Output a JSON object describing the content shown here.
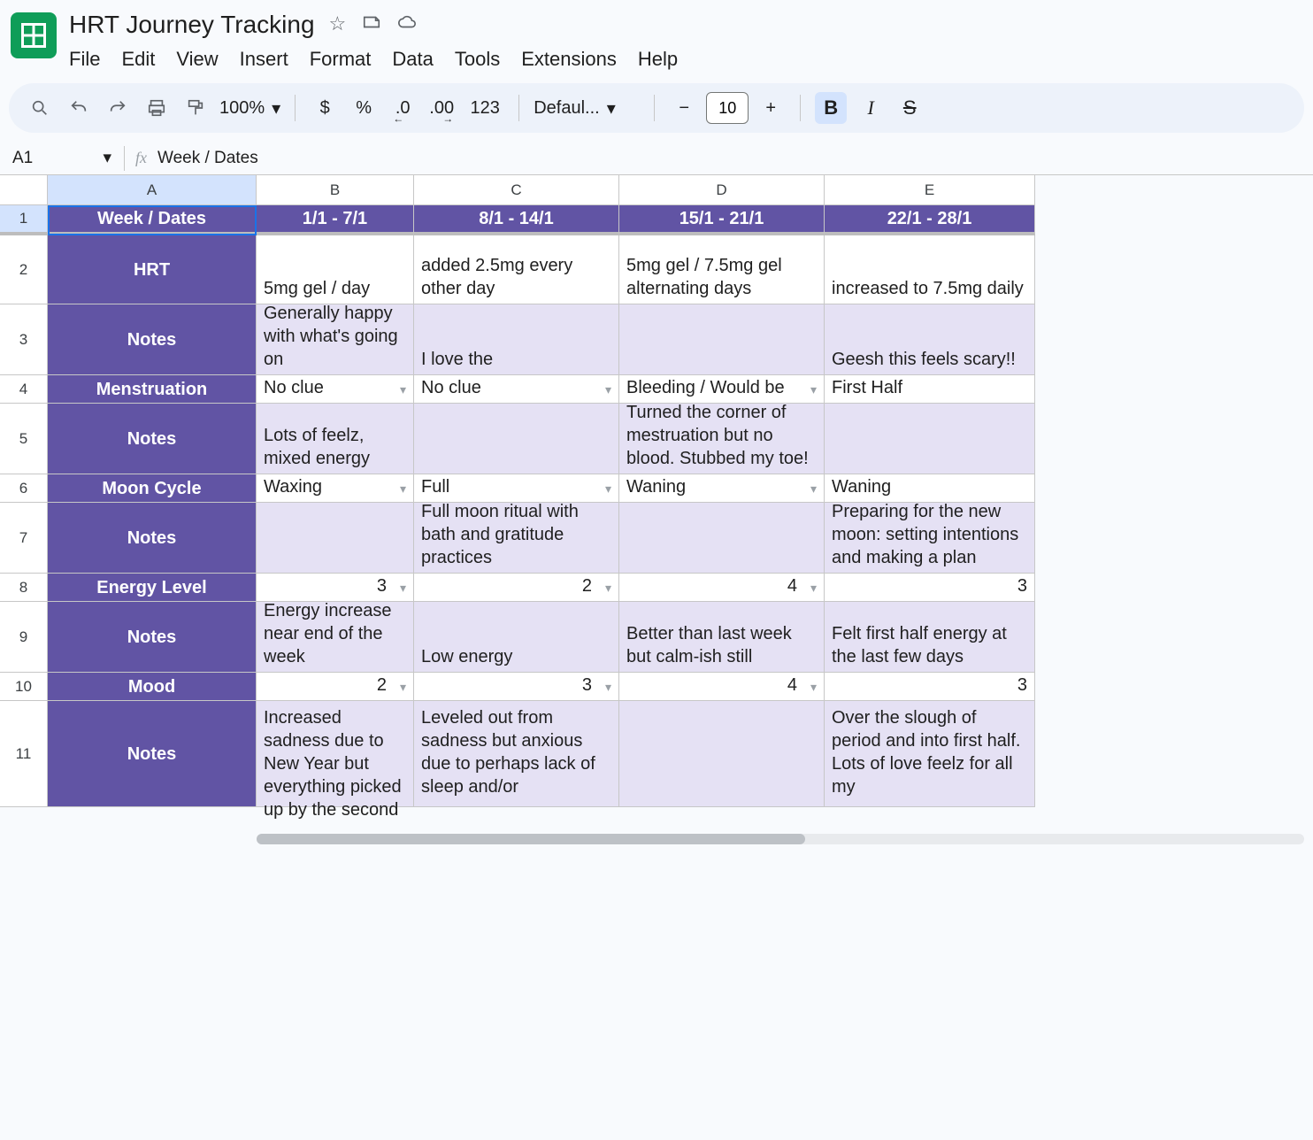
{
  "doc": {
    "title": "HRT Journey Tracking"
  },
  "menu": {
    "file": "File",
    "edit": "Edit",
    "view": "View",
    "insert": "Insert",
    "format": "Format",
    "data": "Data",
    "tools": "Tools",
    "extensions": "Extensions",
    "help": "Help"
  },
  "toolbar": {
    "zoom": "100%",
    "currency": "$",
    "percent": "%",
    "dec_dec": ".0",
    "inc_dec": ".00",
    "num_fmt": "123",
    "font_name": "Defaul...",
    "minus": "−",
    "font_size": "10",
    "plus": "+",
    "bold": "B",
    "italic": "I",
    "strike": "S"
  },
  "namebox": {
    "ref": "A1",
    "formula": "Week / Dates",
    "fx": "fx"
  },
  "headers": {
    "A": "A",
    "B": "B",
    "C": "C",
    "D": "D",
    "E": "E"
  },
  "rows": {
    "r1": "1",
    "r2": "2",
    "r3": "3",
    "r4": "4",
    "r5": "5",
    "r6": "6",
    "r7": "7",
    "r8": "8",
    "r9": "9",
    "r10": "10",
    "r11": "11"
  },
  "row_labels": {
    "week_dates": "Week / Dates",
    "hrt": "HRT",
    "notes": "Notes",
    "menstruation": "Menstruation",
    "moon": "Moon Cycle",
    "energy": "Energy Level",
    "mood": "Mood"
  },
  "week": {
    "b": "1/1 - 7/1",
    "c": "8/1 - 14/1",
    "d": "15/1 - 21/1",
    "e": "22/1 - 28/1"
  },
  "hrt": {
    "b": "5mg gel / day",
    "c": "added 2.5mg every other day",
    "d": "5mg gel / 7.5mg gel alternating days",
    "e": "increased to 7.5mg daily"
  },
  "hrt_notes": {
    "b": "Generally happy with what's going on",
    "c": "I love the",
    "d": "",
    "e": "Geesh this feels scary!!"
  },
  "menstruation": {
    "b": "No clue",
    "c": "No clue",
    "d": "Bleeding / Would be",
    "e": "First Half"
  },
  "men_notes": {
    "b": "Lots of feelz, mixed energy",
    "c": "",
    "d": "Turned the corner of mestruation but no blood. Stubbed my toe!",
    "e": ""
  },
  "moon": {
    "b": "Waxing",
    "c": "Full",
    "d": "Waning",
    "e": "Waning"
  },
  "moon_notes": {
    "b": "",
    "c": "Full moon ritual with bath and gratitude practices",
    "d": "",
    "e": "Preparing for the new moon: setting intentions and making a plan"
  },
  "energy": {
    "b": "3",
    "c": "2",
    "d": "4",
    "e": "3"
  },
  "energy_notes": {
    "b": "Energy increase near end of the week",
    "c": "Low energy",
    "d": "Better than last week but calm-ish still",
    "e": "Felt first half energy at the last few days"
  },
  "mood": {
    "b": "2",
    "c": "3",
    "d": "4",
    "e": "3"
  },
  "mood_notes": {
    "b": "Increased sadness due to New Year but everything picked up by the second",
    "c": "Leveled out from sadness but anxious due to perhaps lack of sleep and/or",
    "d": "",
    "e": "Over the slough of period and into first half. Lots of love feelz for all my"
  }
}
